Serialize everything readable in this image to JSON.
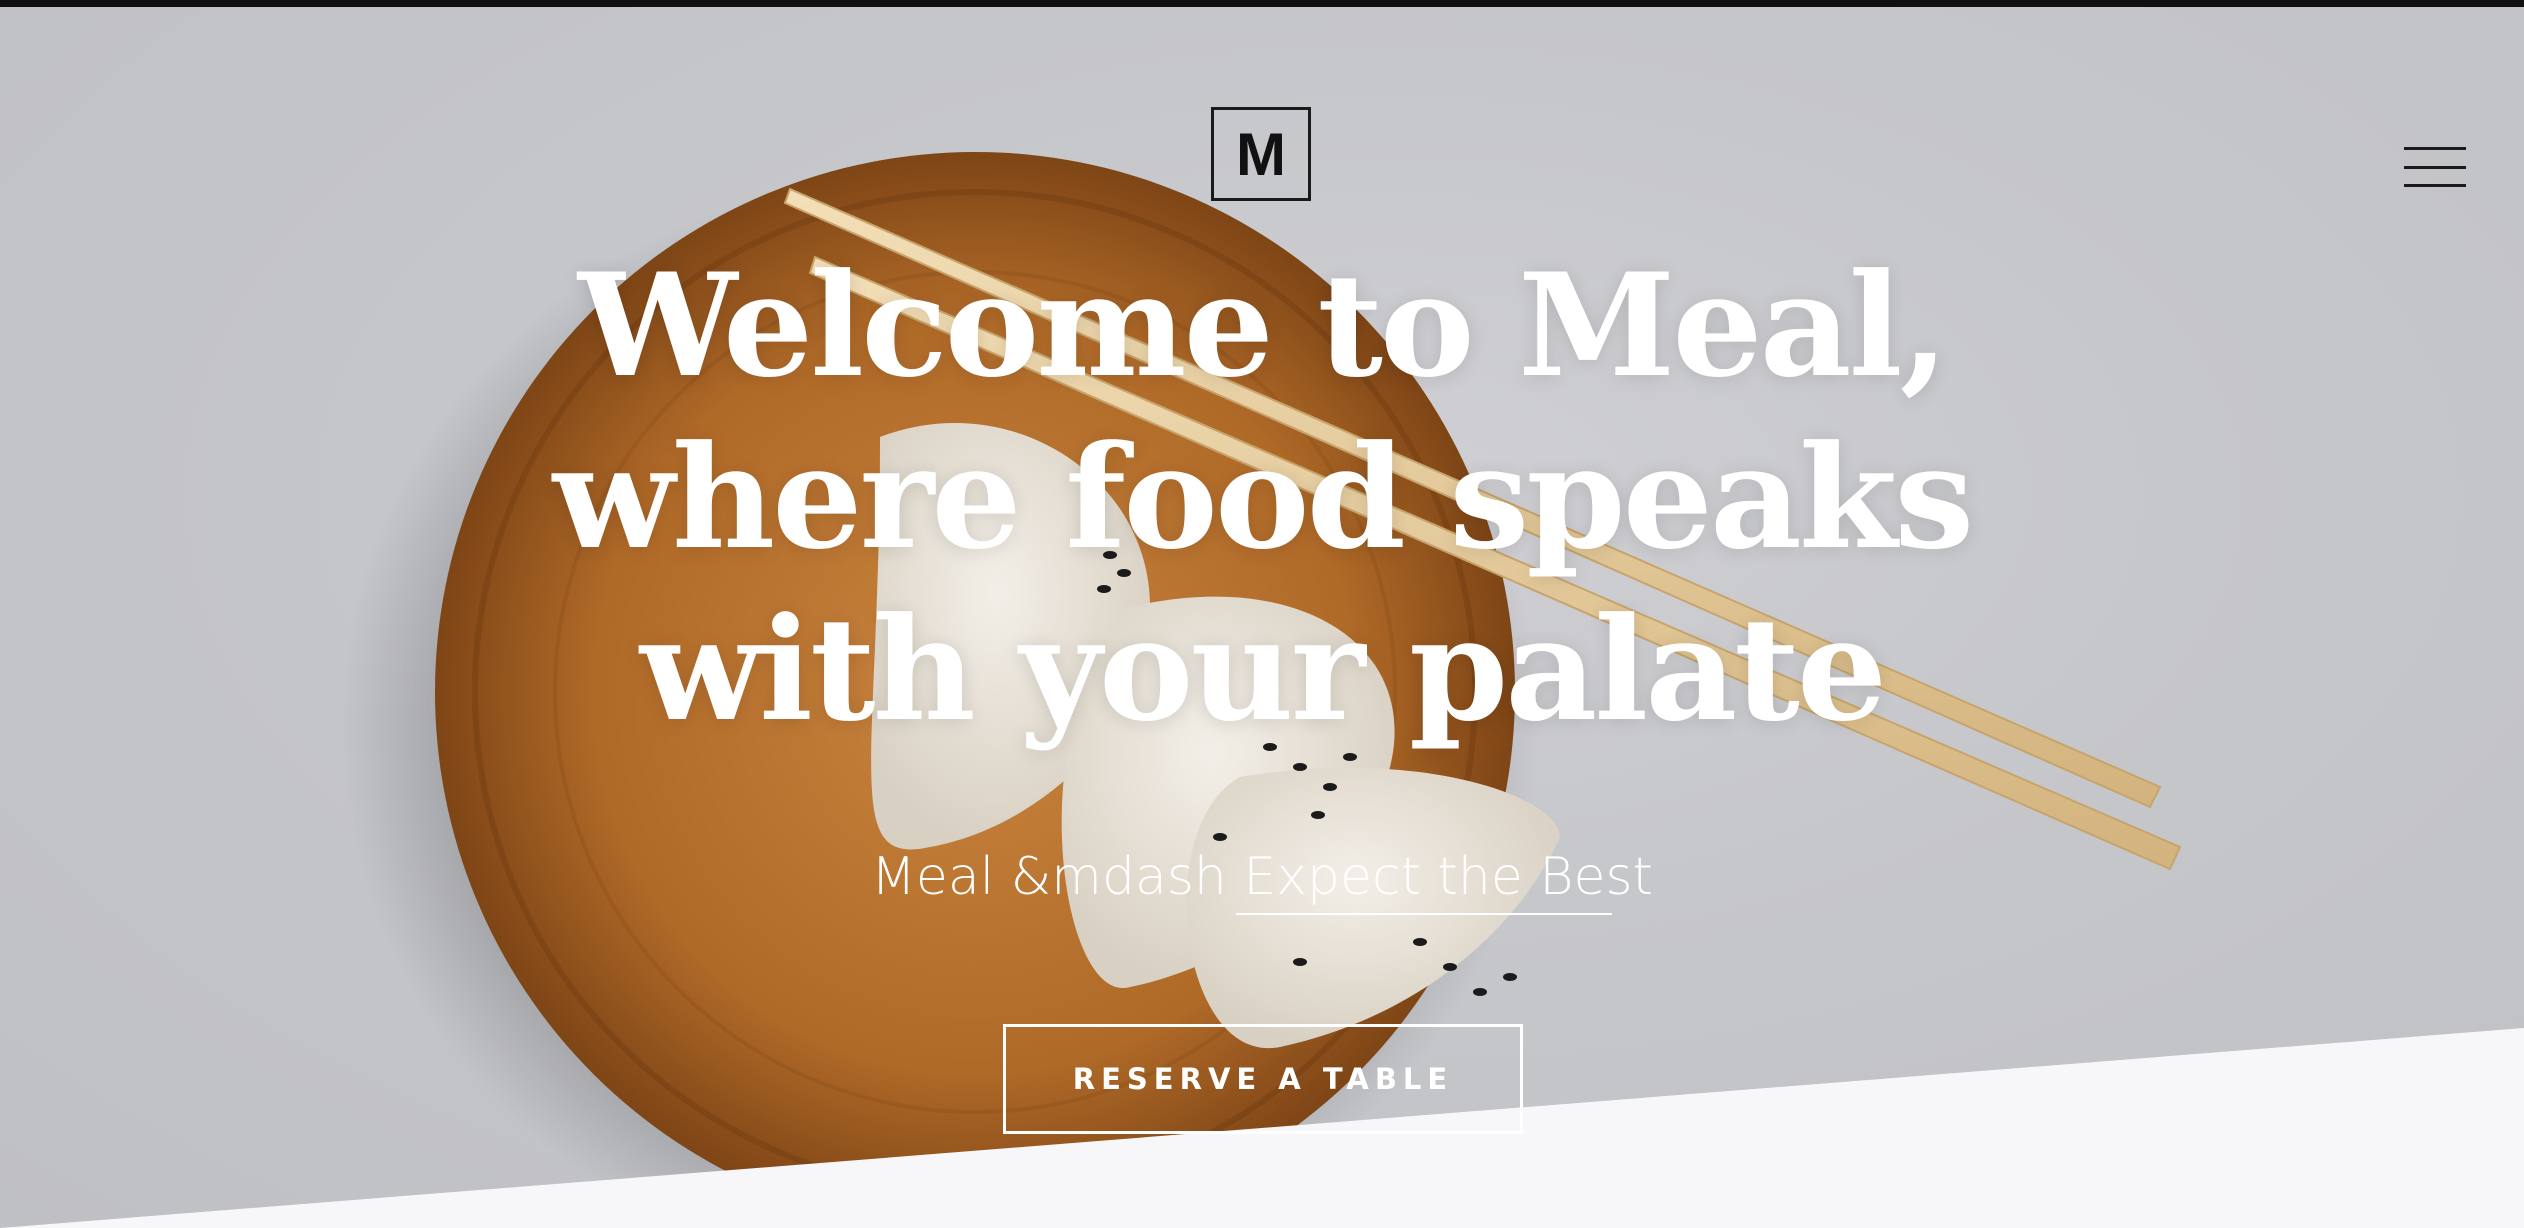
{
  "header": {
    "logo_text": "M",
    "menu_icon": "hamburger-icon"
  },
  "hero": {
    "headline": "Welcome to Meal, where food speaks with your palate",
    "tagline": "Meal &mdash Expect the Best",
    "cta_label": "RESERVE A TABLE"
  },
  "colors": {
    "background": "#c6c7cb",
    "accent": "#ffffff",
    "wood": "#b5702d",
    "section_bottom": "#f7f7f9"
  }
}
